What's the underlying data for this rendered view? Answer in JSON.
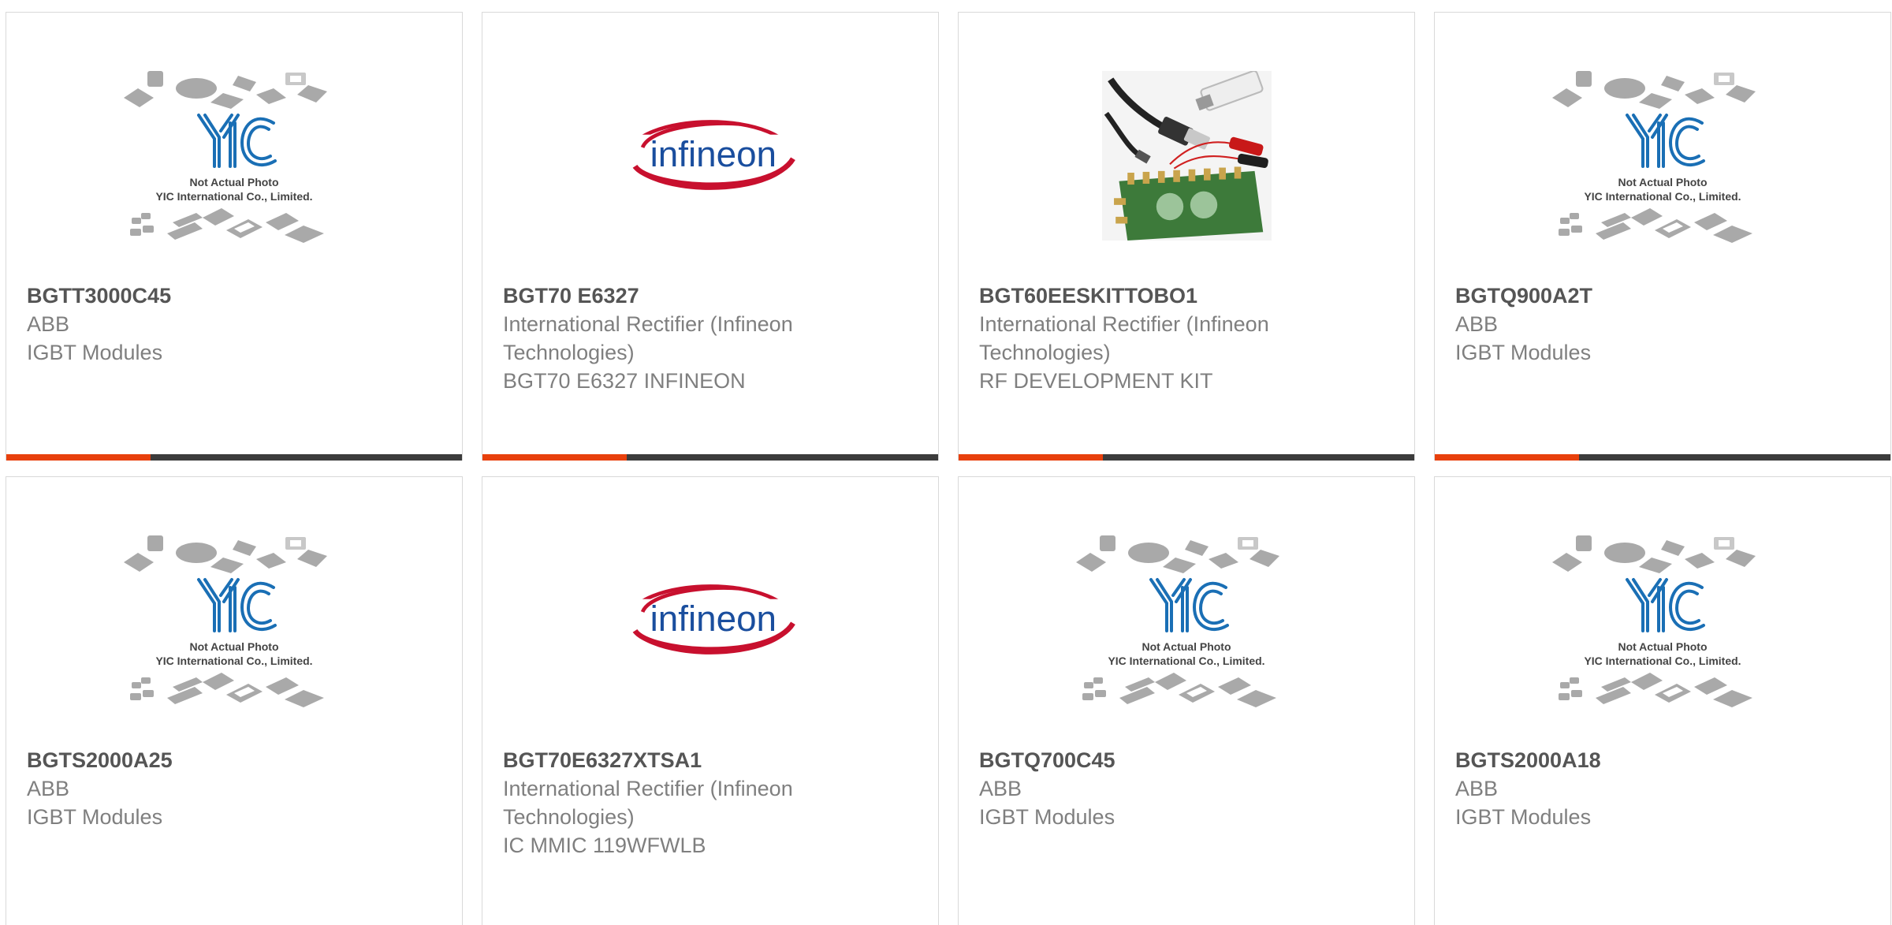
{
  "colors": {
    "accent": "#e8400c",
    "bar": "#3c3c3c",
    "part_text": "#555555",
    "meta_text": "#7f7f7f",
    "card_border": "#d9d9d9",
    "yic_blue": "#1a6fb5",
    "infineon_red": "#c8102e",
    "infineon_blue": "#1a4e9e"
  },
  "placeholder": {
    "line1": "Not Actual Photo",
    "line2": "YIC International Co., Limited.",
    "logo_text": "YIC"
  },
  "infineon_logo_text": "infineon",
  "products": [
    {
      "image": "yic-placeholder",
      "part": "BGTT3000C45",
      "manufacturer": "ABB",
      "description": "IGBT Modules"
    },
    {
      "image": "infineon-logo",
      "part": "BGT70 E6327",
      "manufacturer": "International Rectifier (Infineon Technologies)",
      "description": "BGT70 E6327 INFINEON"
    },
    {
      "image": "dev-kit-photo",
      "part": "BGT60EESKITTOBO1",
      "manufacturer": "International Rectifier (Infineon Technologies)",
      "description": "RF DEVELOPMENT KIT"
    },
    {
      "image": "yic-placeholder",
      "part": "BGTQ900A2T",
      "manufacturer": "ABB",
      "description": "IGBT Modules"
    },
    {
      "image": "yic-placeholder",
      "part": "BGTS2000A25",
      "manufacturer": "ABB",
      "description": "IGBT Modules"
    },
    {
      "image": "infineon-logo",
      "part": "BGT70E6327XTSA1",
      "manufacturer": "International Rectifier (Infineon Technologies)",
      "description": "IC MMIC 119WFWLB"
    },
    {
      "image": "yic-placeholder",
      "part": "BGTQ700C45",
      "manufacturer": "ABB",
      "description": "IGBT Modules"
    },
    {
      "image": "yic-placeholder",
      "part": "BGTS2000A18",
      "manufacturer": "ABB",
      "description": "IGBT Modules"
    }
  ]
}
